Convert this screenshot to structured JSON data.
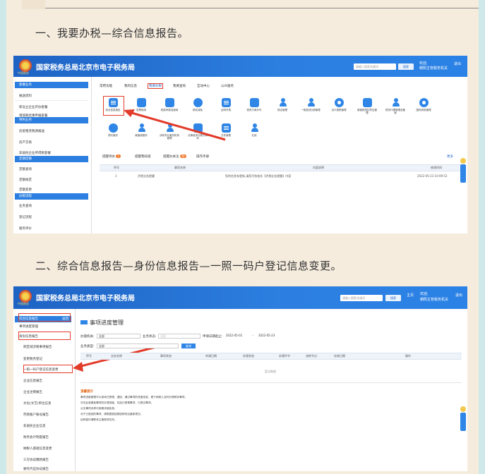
{
  "section1": {
    "heading": "一、我要办税—综合信息报告。",
    "screenshot": {
      "site_title": "国家税务总局北京市电子税务局",
      "emblem_caption": "中国税务",
      "search_placeholder": "请输入搜索关键词",
      "search_button": "搜索",
      "user_greeting": "欢迎,",
      "user_org": "朝阳主管税务机关",
      "logout": "退出",
      "sidebar": {
        "groups": [
          {
            "title": "套餐业务",
            "items": [
              "报送资料",
              "新设立企业开办套餐",
              "增值税优惠申报套餐"
            ]
          },
          {
            "title": "特色业务",
            "items": [
              "房屋租赁税源报送",
              "房产交易",
              "非居民企业所得税套餐"
            ]
          },
          {
            "title": "定期定额",
            "items": [
              "定额查询",
              "定额核定",
              "定额变更"
            ]
          },
          {
            "title": "办税流程",
            "items": [
              "业务查询",
              "登记流程",
              "服务评价"
            ]
          }
        ]
      },
      "top_tabs": [
        "常用功能",
        "我的信息",
        "我要办税",
        "我要查询",
        "互动中心",
        "公众服务"
      ],
      "icons": [
        {
          "label": "综合信息报告",
          "icon": "report-icon"
        },
        {
          "label": "发票使用",
          "icon": "invoice-icon"
        },
        {
          "label": "税费申报及缴纳",
          "icon": "tax-declare-icon"
        },
        {
          "label": "税收减免",
          "icon": "tax-relief-icon"
        },
        {
          "label": "证明开具",
          "icon": "certificate-icon"
        },
        {
          "label": "税务行政许可",
          "icon": "license-icon"
        },
        {
          "label": "核定管理",
          "icon": "person-icon"
        },
        {
          "label": "一般退(抵)税管理",
          "icon": "person-icon"
        },
        {
          "label": "出口退税管理",
          "icon": "export-refund-icon"
        },
        {
          "label": "增值税抵扣凭证管理",
          "icon": "vat-icon"
        },
        {
          "label": "税务代理管理及备案",
          "icon": "person-icon"
        },
        {
          "label": "国际税收管理",
          "icon": "globe-icon"
        },
        {
          "label": "预约服务",
          "icon": "appointment-icon"
        },
        {
          "label": "增值税服务",
          "icon": "person-icon"
        },
        {
          "label": "涉税专业服务机构管理",
          "icon": "person-icon"
        },
        {
          "label": "法律追责与救济事项",
          "icon": "legal-icon"
        },
        {
          "label": "文件管理",
          "icon": "document-icon"
        },
        {
          "label": "社保",
          "icon": "person-icon"
        }
      ],
      "bottom_tabs": [
        {
          "label": "提醒待办",
          "badge": "1"
        },
        {
          "label": "提醒我知道",
          "badge": ""
        },
        {
          "label": "提醒办关注",
          "badge": "50"
        },
        {
          "label": "操作手册",
          "badge": ""
        }
      ],
      "more": "更多",
      "table_headers": [
        "序号",
        "事项名称",
        "内容说明",
        "修改时间"
      ],
      "table_row": [
        "1",
        "涉税业务提醒",
        "您的信息有更新,请您尽快核实【涉税业务提醒】内容",
        "2022-05-23 10:09:52"
      ]
    }
  },
  "section2": {
    "heading": "二、综合信息报告—身份信息报告—一照一码户登记信息变更。",
    "screenshot": {
      "site_title": "国家税务总局北京市电子税务局",
      "emblem_caption": "中国税务",
      "search_placeholder": "请输入搜索关键词",
      "search_button": "搜索",
      "home": "主页",
      "user_greeting": "欢迎,",
      "user_org": "朝阳主管税务机关",
      "logout": "退出",
      "sidebar_head": "综合信息报告",
      "sidebar_back": "返回",
      "sidebar_items": [
        "事项进度管理",
        "身份信息报告",
        "跨区域涉税事项报告",
        "变更税务登记",
        "一照一码户登记信息变更",
        "企业信息报告",
        "企业注销报告",
        "文化(文艺)单位信息",
        "存款账户账号报告",
        "非居民企业信息",
        "财务会计制度报告",
        "纳税人基础信息变更",
        "三方协议缴款报告",
        "委托代征协议报告"
      ],
      "panel_title": "事项进度管理",
      "filters": {
        "tax_office_label": "办理机关:",
        "tax_office_value": "全部",
        "status_label": "业务状态:",
        "status_value": "全部",
        "date_label": "申请日期起止:",
        "date_from": "2022-05-01",
        "date_to": "2022-05-23",
        "type_label": "业务类型:",
        "type_value": "全部",
        "query_button": "查询"
      },
      "table_headers": [
        "序号",
        "业务名称",
        "事项状态",
        "申请日期",
        "办理状态",
        "办理环节",
        "流转节点",
        "办结日期",
        "操作"
      ],
      "empty_text": "暂无数据",
      "tips_title": "温馨提示",
      "tips": [
        "事项进度管理可以查询已受理、退回、通过事项的进度信息，便于纳税人及时办理税务事项。",
        "可在此查看各事项的办理进度，包括已受理事项、已提交事项。",
        "点击事项名称可查看详细信息。",
        "对于已退回的事项，请根据退回原因修改后重新提交。",
        "如有疑问请联系主管税务机关。"
      ]
    }
  },
  "colors": {
    "topbar_blue": "#1e63c4",
    "accent_blue": "#2f86e6",
    "highlight_red": "#e23b2a",
    "badge_orange": "#f0782b",
    "page_bg": "#f5ecde"
  }
}
